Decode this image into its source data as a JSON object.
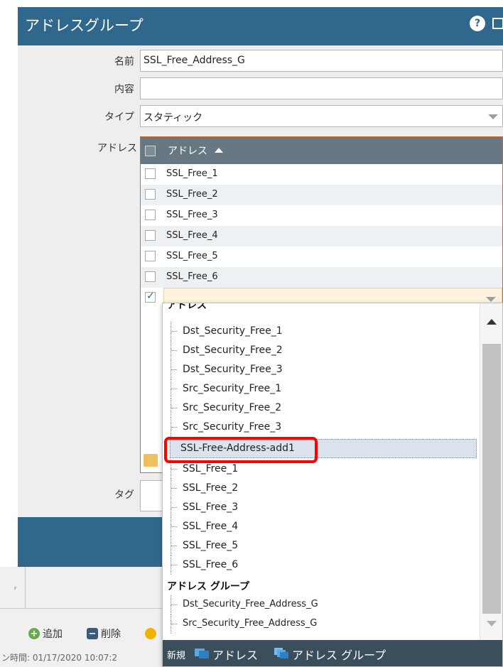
{
  "dialog": {
    "title": "アドレスグループ",
    "help_icon": "?",
    "fields": {
      "name_label": "名前",
      "name_value": "SSL_Free_Address_G",
      "description_label": "内容",
      "description_value": "",
      "type_label": "タイプ",
      "type_value": "スタティック",
      "address_label": "アドレス",
      "tag_label": "タグ"
    },
    "grid": {
      "header": "アドレス",
      "rows": [
        "SSL_Free_1",
        "SSL_Free_2",
        "SSL_Free_3",
        "SSL_Free_4",
        "SSL_Free_5",
        "SSL_Free_6"
      ],
      "editing_row_value": ""
    }
  },
  "dropdown": {
    "group_addresses_label": "アドレス",
    "addresses": [
      "Dst_Security_Free_1",
      "Dst_Security_Free_2",
      "Dst_Security_Free_3",
      "Src_Security_Free_1",
      "Src_Security_Free_2",
      "Src_Security_Free_3",
      "SSL-Free-Address-add1",
      "SSL_Free_1",
      "SSL_Free_2",
      "SSL_Free_3",
      "SSL_Free_4",
      "SSL_Free_5",
      "SSL_Free_6"
    ],
    "selected_item": "SSL-Free-Address-add1",
    "group_groups_label": "アドレス グループ",
    "groups": [
      "Dst_Security_Free_Address_G",
      "Src_Security_Free_Address_G"
    ],
    "footer": {
      "new_label": "新規",
      "address_button": "アドレス",
      "address_group_button": "アドレス グループ"
    }
  },
  "background": {
    "add_label": "追加",
    "delete_label": "削除",
    "status_text": "ン時間: 01/17/2020 10:07:2"
  },
  "colors": {
    "title_bar": "#30688d",
    "grid_header": "#687883",
    "grid_border": "#d2691e",
    "highlight": "#ff0000",
    "dropdown_footer": "#3b4e5c"
  }
}
